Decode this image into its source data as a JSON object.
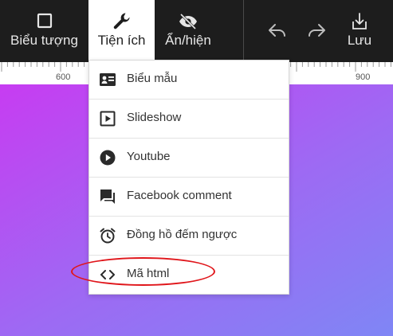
{
  "toolbar": {
    "items": [
      {
        "label": "Biểu tượng",
        "icon": "square-outline-icon"
      },
      {
        "label": "Tiện ích",
        "icon": "wrench-icon"
      },
      {
        "label": "Ẩn/hiện",
        "icon": "eye-off-icon"
      },
      {
        "label": "",
        "icon": "undo-icon"
      },
      {
        "label": "",
        "icon": "redo-icon"
      },
      {
        "label": "Lưu",
        "icon": "save-download-icon"
      }
    ],
    "active_item": "Tiện ích"
  },
  "ruler": {
    "labels": [
      "600",
      "900"
    ]
  },
  "menu": {
    "items": [
      {
        "label": "Biểu mẫu",
        "icon": "form-card-icon"
      },
      {
        "label": "Slideshow",
        "icon": "play-square-icon"
      },
      {
        "label": "Youtube",
        "icon": "play-circle-icon"
      },
      {
        "label": "Facebook comment",
        "icon": "comment-icon"
      },
      {
        "label": "Đồng hồ đếm ngược",
        "icon": "alarm-clock-icon"
      },
      {
        "label": "Mã html",
        "icon": "code-icon"
      }
    ],
    "highlighted_item": "Mã html"
  },
  "colors": {
    "toolbar_bg": "#1d1d1d",
    "canvas_gradient_start": "#c73cf2",
    "canvas_gradient_end": "#7f86f5",
    "highlight": "#e0161b"
  }
}
